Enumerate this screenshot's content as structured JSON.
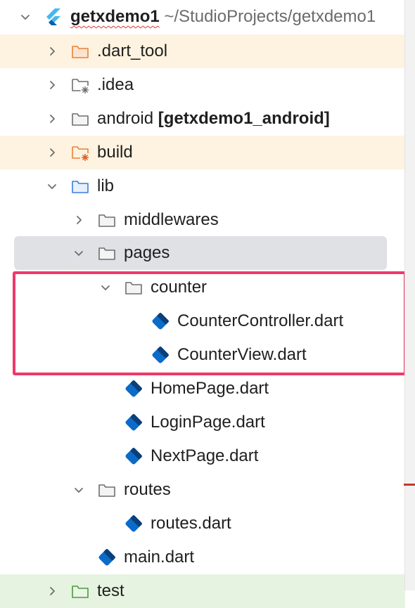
{
  "tree": {
    "project_name": "getxdemo1",
    "project_path": "~/StudioProjects/getxdemo1",
    "items": [
      {
        "label": ".dart_tool",
        "type": "folder-excluded"
      },
      {
        "label": ".idea",
        "type": "folder-config"
      },
      {
        "label": "android",
        "module": "[getxdemo1_android]",
        "type": "folder"
      },
      {
        "label": "build",
        "type": "folder-excluded"
      },
      {
        "label": "lib",
        "type": "folder-source"
      },
      {
        "label": "middlewares",
        "type": "folder"
      },
      {
        "label": "pages",
        "type": "folder"
      },
      {
        "label": "counter",
        "type": "folder"
      },
      {
        "label": "CounterController.dart",
        "type": "dart-file"
      },
      {
        "label": "CounterView.dart",
        "type": "dart-file"
      },
      {
        "label": "HomePage.dart",
        "type": "dart-file"
      },
      {
        "label": "LoginPage.dart",
        "type": "dart-file"
      },
      {
        "label": "NextPage.dart",
        "type": "dart-file"
      },
      {
        "label": "routes",
        "type": "folder"
      },
      {
        "label": "routes.dart",
        "type": "dart-file"
      },
      {
        "label": "main.dart",
        "type": "dart-file"
      },
      {
        "label": "test",
        "type": "folder-test"
      }
    ]
  },
  "colors": {
    "excluded_bg": "#fdf3e0",
    "selected_bg": "#dfe1e5",
    "test_bg": "#e6f3e1",
    "highlight_border": "#f0386b",
    "dart_blue": "#0b6bc8"
  },
  "icons": {
    "expand": "chevron-right-icon",
    "collapse": "chevron-down-icon",
    "project": "flutter-icon",
    "folder": "folder-icon",
    "source_folder": "source-folder-icon",
    "excluded_folder": "excluded-folder-icon",
    "dart_file": "dart-file-icon"
  }
}
